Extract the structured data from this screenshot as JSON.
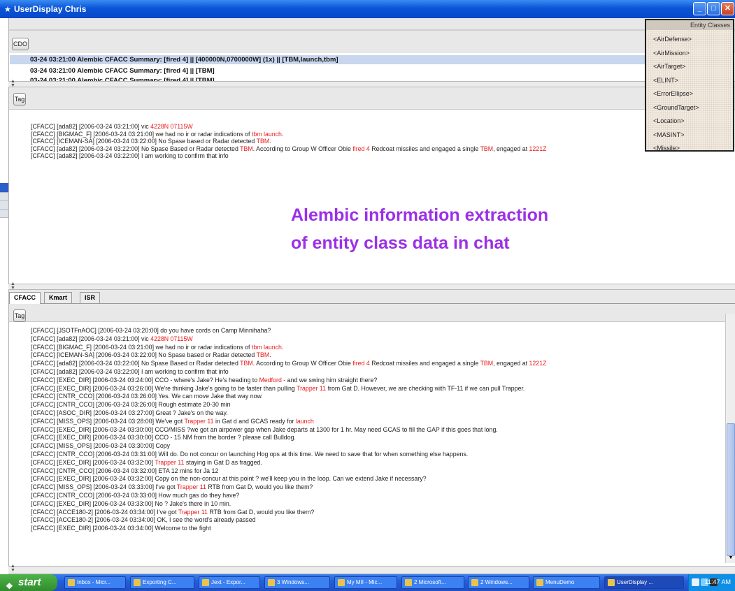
{
  "window": {
    "title": "UserDisplay Chris"
  },
  "top_panel": {
    "cdo_button": "CDO",
    "summaries": [
      "03-24 03:21:00 Alembic CFACC   Summary: [fired 4] || [400000N,0700000W] (1x) || [TBM,launch,tbm]",
      "03-24 03:21:00 Alembic CFACC   Summary: [fired 4] || [TBM]",
      "03-24 03:21:00 Alembic CFACC   Summary: [fired 4] || [TBM]"
    ]
  },
  "middle_panel": {
    "tag_button": "Tag",
    "lines": [
      [
        {
          "t": "[CFACC] [ada82] [2006-03-24 03:21:00] vic "
        },
        {
          "t": "4228N 07115W",
          "hl": true
        }
      ],
      [
        {
          "t": "[CFACC] [BIGMAC_F] [2006-03-24 03:21:00] we had no ir or radar indications of "
        },
        {
          "t": "tbm launch",
          "hl": true
        },
        {
          "t": "."
        }
      ],
      [
        {
          "t": "[CFACC] [ICEMAN-SA] [2006-03-24 03:22:00] No Spase based or Radar detected "
        },
        {
          "t": "TBM",
          "hl": true
        },
        {
          "t": "."
        }
      ],
      [
        {
          "t": "[CFACC] [ada82] [2006-03-24 03:22:00] No Spase Based or Radar detected "
        },
        {
          "t": "TBM",
          "hl": true
        },
        {
          "t": ". According to Group W Officer Obie "
        },
        {
          "t": "fired 4",
          "hl": true
        },
        {
          "t": " Redcoat missiles and engaged a single "
        },
        {
          "t": "TBM",
          "hl": true
        },
        {
          "t": ", engaged at "
        },
        {
          "t": "1221Z",
          "hl": true
        }
      ],
      [
        {
          "t": "[CFACC] [ada82] [2006-03-24 03:22:00] I am working to confirm that info"
        }
      ]
    ]
  },
  "entity_classes": {
    "header": "Entity Classes",
    "items": [
      "<AirDefense>",
      "<AirMission>",
      "<AirTarget>",
      "<ELINT>",
      "<ErrorEllipse>",
      "<GroundTarget>",
      "<Location>",
      "<MASINT>",
      "<Missile>"
    ]
  },
  "annotation": {
    "line1": "Alembic information extraction",
    "line2": "of entity class data in chat"
  },
  "tabs": [
    "CFACC",
    "Kmart",
    "ISR"
  ],
  "bottom_panel": {
    "tag_button": "Tag",
    "lines": [
      [
        {
          "t": "[CFACC] [JSOTFnAOC] [2006-03-24 03:20:00] do you have cords on Camp Minnihaha?"
        }
      ],
      [
        {
          "t": "[CFACC] [ada82] [2006-03-24 03:21:00] vic "
        },
        {
          "t": "4228N 07115W",
          "hl": true
        }
      ],
      [
        {
          "t": "[CFACC] [BIGMAC_F] [2006-03-24 03:21:00] we had no ir or radar indications of "
        },
        {
          "t": "tbm launch",
          "hl": true
        },
        {
          "t": "."
        }
      ],
      [
        {
          "t": "[CFACC] [ICEMAN-SA] [2006-03-24 03:22:00] No Spase based or Radar detected "
        },
        {
          "t": "TBM",
          "hl": true
        },
        {
          "t": "."
        }
      ],
      [
        {
          "t": "[CFACC] [ada82] [2006-03-24 03:22:00] No Spase Based or Radar detected "
        },
        {
          "t": "TBM",
          "hl": true
        },
        {
          "t": ". According to Group W Officer Obie "
        },
        {
          "t": "fired 4",
          "hl": true
        },
        {
          "t": " Redcoat missiles and engaged a single "
        },
        {
          "t": "TBM",
          "hl": true
        },
        {
          "t": ", engaged at "
        },
        {
          "t": "1221Z",
          "hl": true
        }
      ],
      [
        {
          "t": "[CFACC] [ada82] [2006-03-24 03:22:00] I am working to confirm that info"
        }
      ],
      [
        {
          "t": "[CFACC] [EXEC_DIR] [2006-03-24 03:24:00] CCO - where's Jake? He's heading to "
        },
        {
          "t": "Medford",
          "hl": true
        },
        {
          "t": " - and we swing him straight there?"
        }
      ],
      [
        {
          "t": "[CFACC] [EXEC_DIR] [2006-03-24 03:26:00] We're thinking Jake's going to be faster than pulling "
        },
        {
          "t": "Trapper 11",
          "hl": true
        },
        {
          "t": " from Gat D. However, we are checking with TF-11 if we can pull Trapper."
        }
      ],
      [
        {
          "t": "[CFACC] [CNTR_CCO] [2006-03-24 03:26:00] Yes. We can move Jake that way now."
        }
      ],
      [
        {
          "t": "[CFACC] [CNTR_CCO] [2006-03-24 03:26:00] Rough estimate 20-30 min"
        }
      ],
      [
        {
          "t": "[CFACC] [ASOC_DIR] [2006-03-24 03:27:00] Great ? Jake's on the way."
        }
      ],
      [
        {
          "t": "[CFACC] [MISS_OPS] [2006-03-24 03:28:00] We've got "
        },
        {
          "t": "Trapper 11",
          "hl": true
        },
        {
          "t": " in Gat d and GCAS ready for "
        },
        {
          "t": "launch",
          "hl": true
        }
      ],
      [
        {
          "t": "[CFACC] [EXEC_DIR] [2006-03-24 03:30:00] CCO/MISS ?we got an airpower gap when Jake departs at 1300 for 1 hr. May need GCAS to fill the GAP if this goes that long."
        }
      ],
      [
        {
          "t": "[CFACC] [EXEC_DIR] [2006-03-24 03:30:00] CCO - 15 NM from the border ? please call Bulldog."
        }
      ],
      [
        {
          "t": "[CFACC] [MISS_OPS] [2006-03-24 03:30:00] Copy"
        }
      ],
      [
        {
          "t": "[CFACC] [CNTR_CCO] [2006-03-24 03:31:00] Will do. Do not concur on launching Hog ops at this time. We need to save that for when something else happens."
        }
      ],
      [
        {
          "t": "[CFACC] [EXEC_DIR] [2006-03-24 03:32:00] "
        },
        {
          "t": "Trapper 11",
          "hl": true
        },
        {
          "t": " staying in Gat D as fragged."
        }
      ],
      [
        {
          "t": "[CFACC] [CNTR_CCO] [2006-03-24 03:32:00] ETA 12 mins for Ja 12"
        }
      ],
      [
        {
          "t": "[CFACC] [EXEC_DIR] [2006-03-24 03:32:00] Copy on the non-concur at this point ? we'll keep you in the loop. Can we extend Jake if necessary?"
        }
      ],
      [
        {
          "t": "[CFACC] [MISS_OPS] [2006-03-24 03:33:00] I've got "
        },
        {
          "t": "Trapper 11",
          "hl": true
        },
        {
          "t": " RTB from Gat D, would you like them?"
        }
      ],
      [
        {
          "t": "[CFACC] [CNTR_CCO] [2006-03-24 03:33:00] How much gas do they have?"
        }
      ],
      [
        {
          "t": "[CFACC] [EXEC_DIR] [2006-03-24 03:33:00] No ? Jake's there in 10 min."
        }
      ],
      [
        {
          "t": "[CFACC] [ACCE180-2] [2006-03-24 03:34:00] I've got "
        },
        {
          "t": "Trapper 11",
          "hl": true
        },
        {
          "t": " RTB from Gat D, would you like them?"
        }
      ],
      [
        {
          "t": "[CFACC] [ACCE180-2] [2006-03-24 03:34:00] OK, I see the word's already passed"
        }
      ],
      [
        {
          "t": "[CFACC] [EXEC_DIR] [2006-03-24 03:34:00] Welcome to the fight"
        }
      ]
    ]
  },
  "taskbar": {
    "start": "start",
    "items": [
      "Inbox - Micr...",
      "Exporting C...",
      "Jext - Expor...",
      "3 Windows...",
      "My MII - Mic...",
      "2 Microsoft...",
      "2 Windows...",
      "MenuDemo",
      "UserDisplay ..."
    ],
    "clock": "11:47 AM"
  },
  "colors": {
    "highlight": "#e81a1a",
    "annotation": "#9b30e8",
    "selected_row": "#c8d6ee"
  }
}
